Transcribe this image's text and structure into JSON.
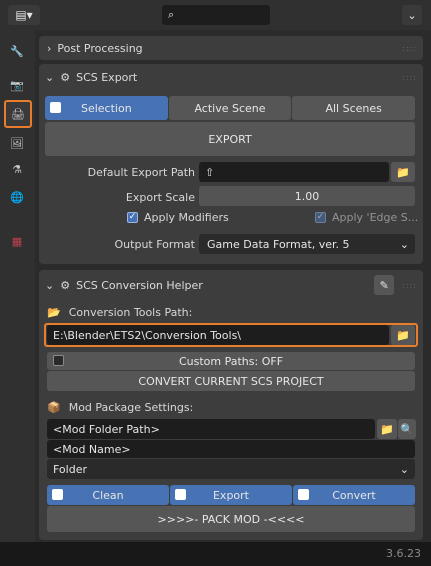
{
  "topbar": {
    "editor_type_icon": "properties-editor-icon",
    "search_placeholder": ""
  },
  "sidebar": {
    "tabs": [
      "tool-icon",
      "render-icon",
      "output-icon",
      "view-layer-icon",
      "scene-icon",
      "world-icon",
      "texture-icon"
    ]
  },
  "post_processing": {
    "title": "Post Processing"
  },
  "scs_export": {
    "title": "SCS Export",
    "tabs": [
      "Selection",
      "Active Scene",
      "All Scenes"
    ],
    "export_button": "EXPORT",
    "default_export_path_label": "Default Export Path",
    "default_export_path_value": "",
    "export_scale_label": "Export Scale",
    "export_scale_value": "1.00",
    "apply_modifiers_label": "Apply Modifiers",
    "apply_edge_split_label": "Apply 'Edge S...",
    "output_format_label": "Output Format",
    "output_format_value": "Game Data Format, ver. 5"
  },
  "conversion_helper": {
    "title": "SCS Conversion Helper",
    "tools_path_label": "Conversion Tools Path:",
    "tools_path_value": "E:\\Blender\\ETS2\\Conversion Tools\\",
    "custom_paths_label": "Custom Paths: OFF",
    "convert_button": "CONVERT CURRENT SCS PROJECT",
    "mod_package_label": "Mod Package Settings:",
    "mod_folder_path": "<Mod Folder Path>",
    "mod_name": "<Mod Name>",
    "mod_type": "Folder",
    "toggles": [
      "Clean",
      "Export",
      "Convert"
    ],
    "pack_button": ">>>>-  PACK MOD  -<<<<"
  },
  "status": {
    "version": "3.6.23"
  },
  "colors": {
    "accent": "#4772b3",
    "highlight": "#e87d2d"
  }
}
